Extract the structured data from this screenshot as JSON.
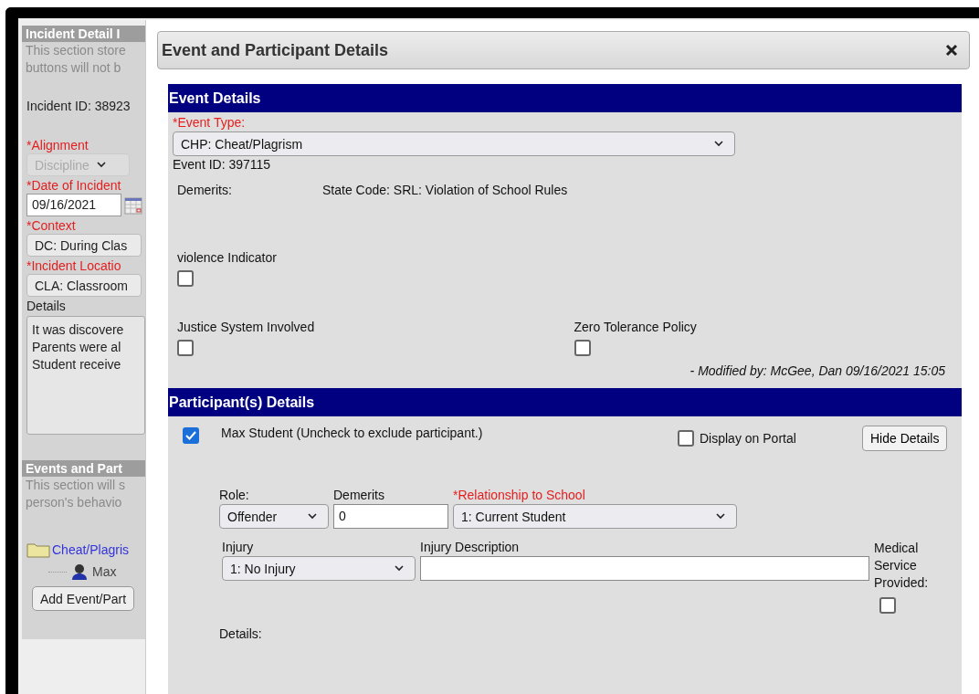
{
  "incident_panel": {
    "title": "Incident Detail I",
    "description": [
      "This section store",
      "buttons will not b"
    ],
    "incident_id": "Incident ID: 38923",
    "fields": [
      {
        "kind": "select",
        "label": "*Alignment",
        "required": true,
        "value": "Discipline",
        "disabled": true
      },
      {
        "kind": "date",
        "label": "*Date of Incident",
        "required": true,
        "value": "09/16/2021",
        "disabled": false
      },
      {
        "kind": "select",
        "label": "*Context",
        "required": true,
        "value": "DC: During Clas",
        "disabled": false
      },
      {
        "kind": "select",
        "label": "*Incident Locatio",
        "required": true,
        "value": "CLA: Classroom",
        "disabled": false
      },
      {
        "kind": "textarea",
        "label": "Details",
        "required": false,
        "lines": [
          "It was discovere",
          "Parents were al",
          "Student receive"
        ],
        "disabled": false
      }
    ]
  },
  "events_panel": {
    "title": "Events and Part",
    "description": [
      "This section will s",
      "person's behavio"
    ],
    "tree": [
      {
        "label": "Cheat/Plagris",
        "children": [
          {
            "label": "Max"
          }
        ]
      }
    ],
    "add_button": "Add Event/Part"
  },
  "dialog": {
    "title": "Event and Participant Details",
    "event_details": {
      "title": "Event Details",
      "event_type": {
        "label": "*Event Type:",
        "required": true,
        "value": "CHP: Cheat/Plagrism"
      },
      "event_id": "Event ID: 397115",
      "demerits_label": "Demerits:",
      "state_code": "State Code: SRL: Violation of School Rules",
      "checkboxes": [
        {
          "label": "violence Indicator",
          "checked": false
        },
        {
          "label": "Justice System Involved",
          "checked": false
        },
        {
          "label": "Zero Tolerance Policy",
          "checked": false
        }
      ],
      "modified": "- Modified by: McGee, Dan 09/16/2021 15:05"
    },
    "participants": {
      "title": "Participant(s) Details",
      "participant": {
        "label": "Max Student (Uncheck to exclude participant.)",
        "checked": true
      },
      "display_on_portal": {
        "label": "Display on Portal",
        "checked": false
      },
      "hide_button": "Hide Details",
      "role": {
        "label": "Role:",
        "value": "Offender"
      },
      "demerits": {
        "label": "Demerits",
        "value": "0"
      },
      "relationship": {
        "label": "*Relationship to School",
        "required": true,
        "value": "1: Current Student"
      },
      "injury": {
        "label": "Injury",
        "value": "1: No Injury"
      },
      "injury_description": {
        "label": "Injury Description"
      },
      "medical": {
        "label": "Medical Service Provided:",
        "checked": false
      },
      "details_label": "Details:"
    }
  }
}
